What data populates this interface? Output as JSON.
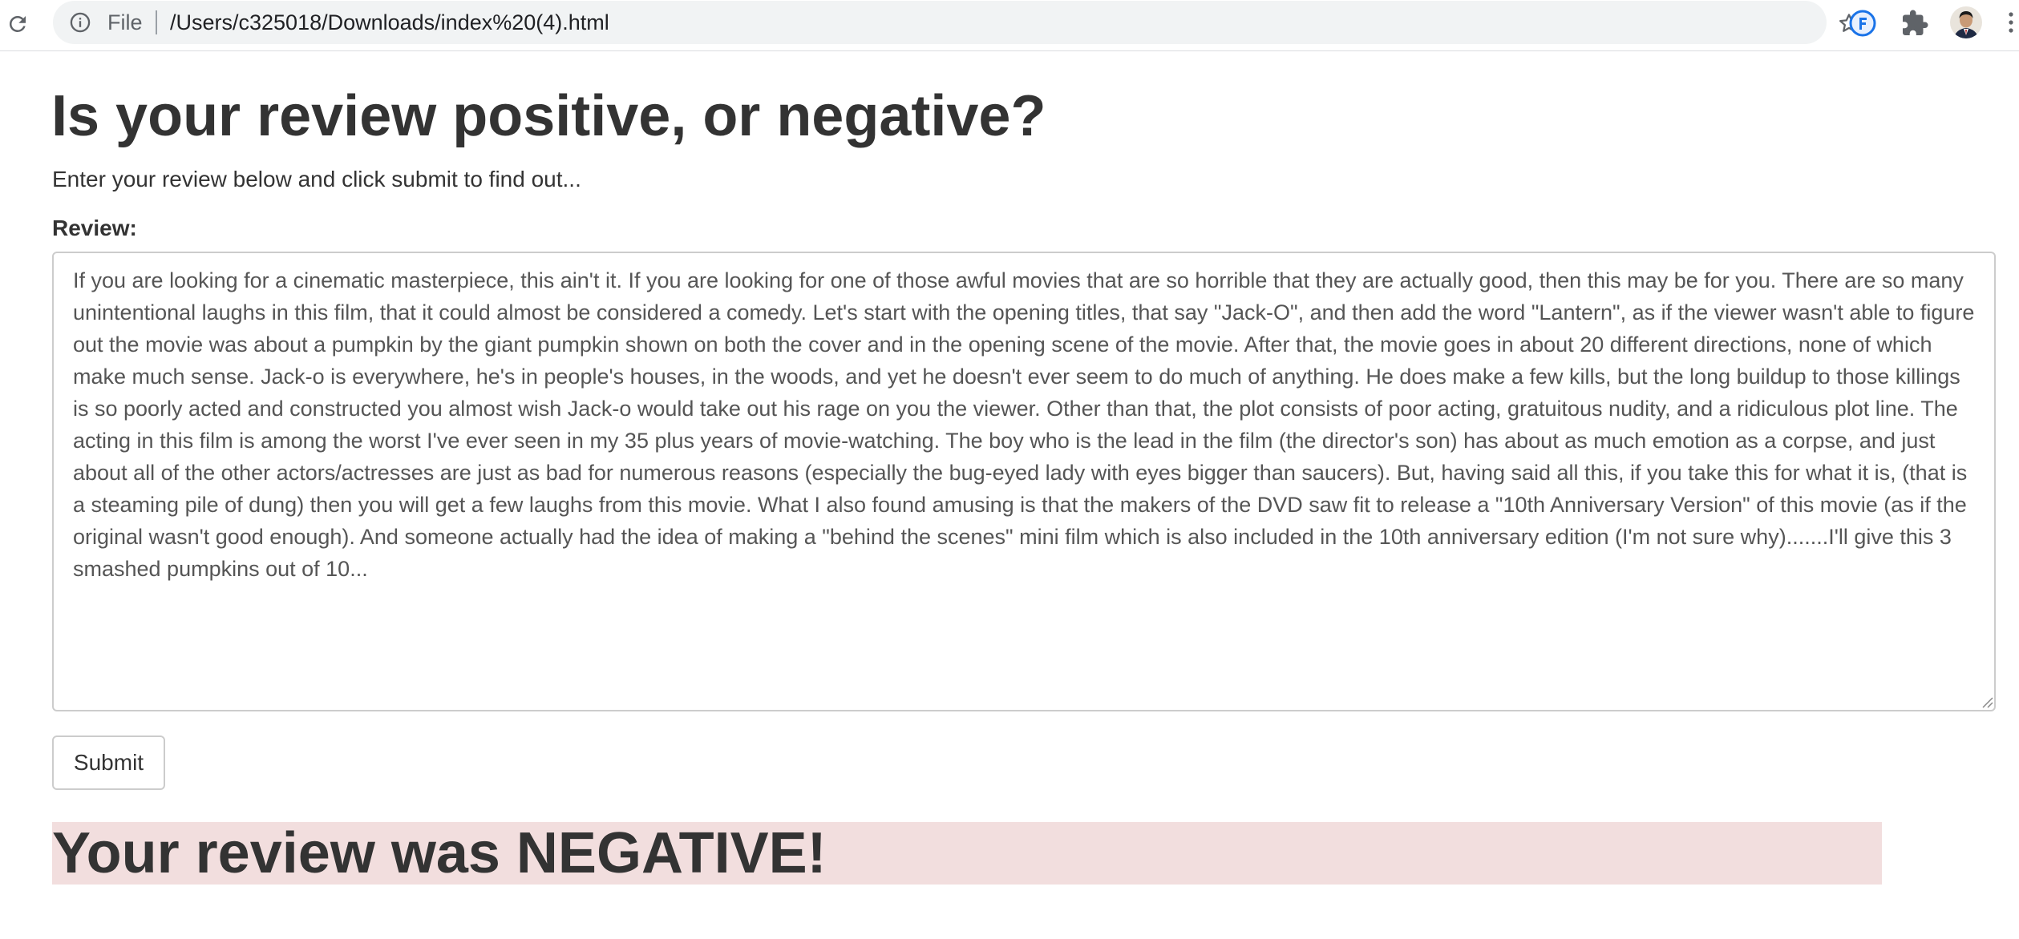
{
  "browser": {
    "scheme_label": "File",
    "url": "/Users/c325018/Downloads/index%20(4).html",
    "icons": [
      "reload-icon",
      "info-icon",
      "star-icon",
      "extension-icon",
      "puzzle-icon",
      "avatar",
      "menu-icon"
    ]
  },
  "page": {
    "title": "Is your review positive, or negative?",
    "intro": "Enter your review below and click submit to find out...",
    "review_label": "Review:",
    "review_text": "If you are looking for a cinematic masterpiece, this ain't it. If you are looking for one of those awful movies that are so horrible that they are actually good, then this may be for you. There are so many unintentional laughs in this film, that it could almost be considered a comedy. Let's start with the opening titles, that say \"Jack-O\", and then add the word \"Lantern\", as if the viewer wasn't able to figure out the movie was about a pumpkin by the giant pumpkin shown on both the cover and in the opening scene of the movie. After that, the movie goes in about 20 different directions, none of which make much sense. Jack-o is everywhere, he's in people's houses, in the woods, and yet he doesn't ever seem to do much of anything. He does make a few kills, but the long buildup to those killings is so poorly acted and constructed you almost wish Jack-o would take out his rage on you the viewer. Other than that, the plot consists of poor acting, gratuitous nudity, and a ridiculous plot line. The acting in this film is among the worst I've ever seen in my 35 plus years of movie-watching. The boy who is the lead in the film (the director's son) has about as much emotion as a corpse, and just about all of the other actors/actresses are just as bad for numerous reasons (especially the bug-eyed lady with eyes bigger than saucers). But, having said all this, if you take this for what it is, (that is a steaming pile of dung) then you will get a few laughs from this movie. What I also found amusing is that the makers of the DVD saw fit to release a \"10th Anniversary Version\" of this movie (as if the original wasn't good enough). And someone actually had the idea of making a \"behind the scenes\" mini film which is also included in the 10th anniversary edition (I'm not sure why).......I'll give this 3 smashed pumpkins out of 10...",
    "submit_label": "Submit",
    "result_text": "Your review was NEGATIVE!"
  },
  "colors": {
    "result_background": "#f2dede",
    "text": "#333333",
    "border": "#cccccc",
    "extension_accent": "#1a73e8"
  }
}
